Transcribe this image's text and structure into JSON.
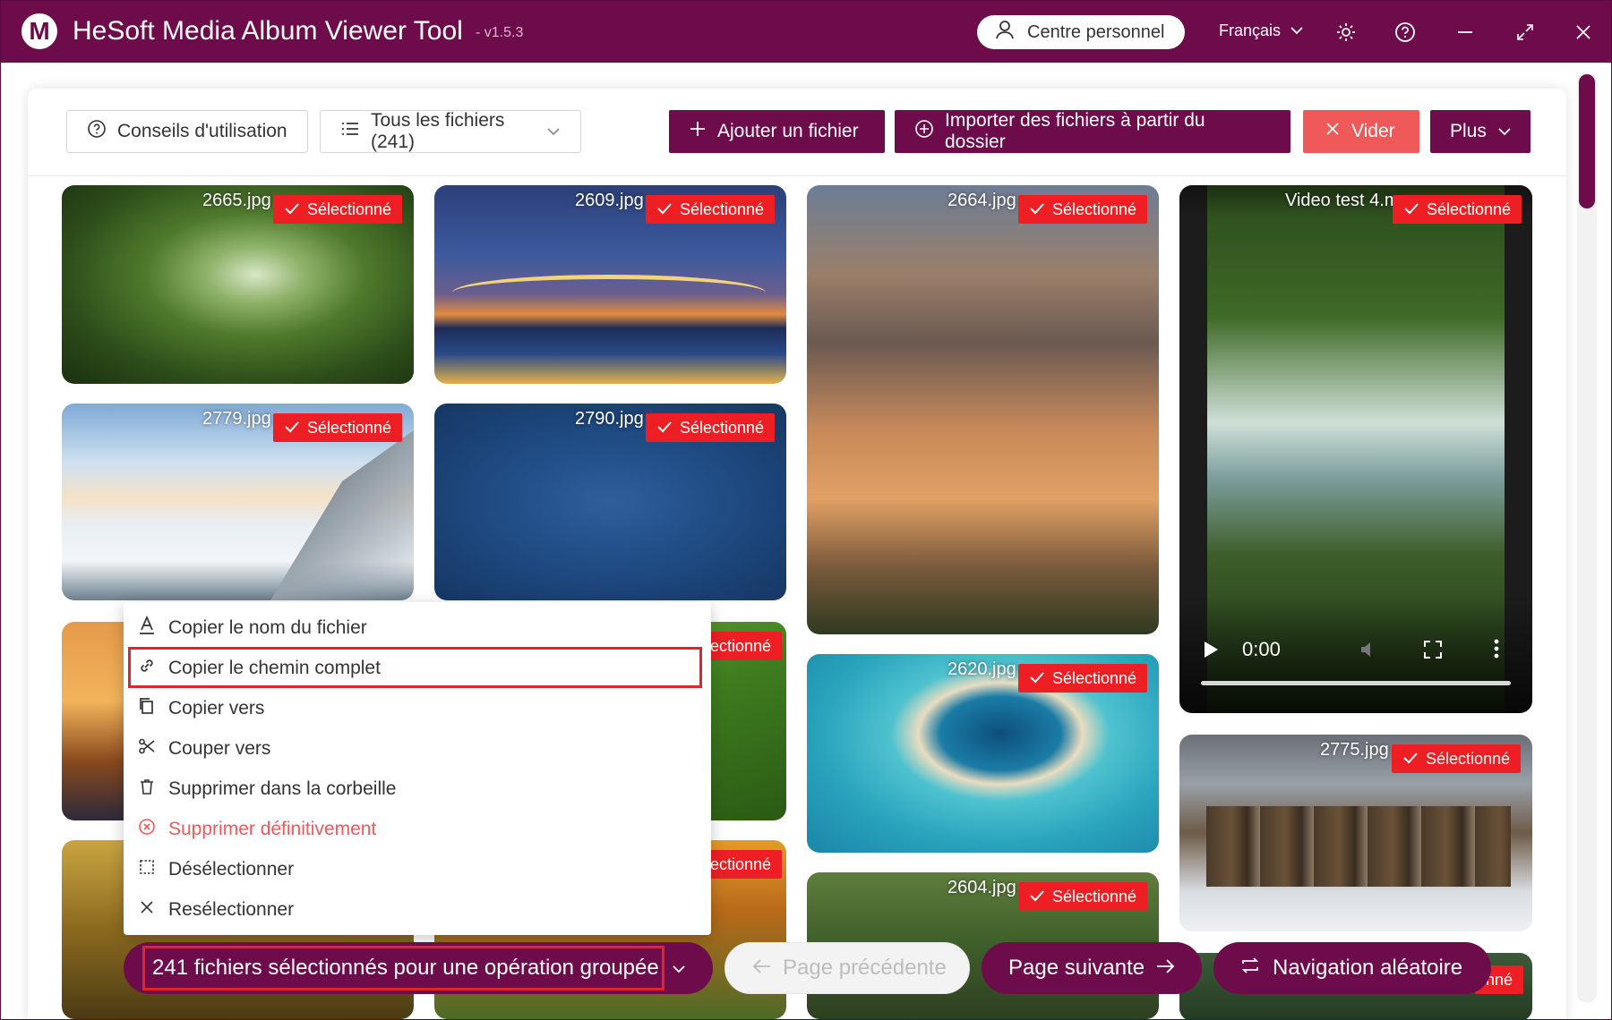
{
  "window": {
    "title": "HeSoft Media Album Viewer Tool",
    "version": "- v1.5.3",
    "logo_letter": "M",
    "personal_center": "Centre personnel",
    "language": "Français"
  },
  "toolbar": {
    "tips": "Conseils d'utilisation",
    "filter": "Tous les fichiers (241)",
    "add_file": "Ajouter un fichier",
    "import_folder": "Importer des fichiers à partir du dossier",
    "clear": "Vider",
    "more": "Plus"
  },
  "selected_label": "Sélectionné",
  "selected_label_partial": "ectionné",
  "selected_label_tail": "nné",
  "tiles": {
    "t1": "2665.jpg",
    "t2": "2609.jpg",
    "t3": "2664.jpg",
    "t4": "Video test 4.m",
    "t5": "2779.jpg",
    "t6": "2790.jpg",
    "t7": "2620.jpg",
    "t8": "2775.jpg",
    "t9": "2604.jpg"
  },
  "video": {
    "time": "0:00"
  },
  "context_menu": {
    "copy_name": "Copier le nom du fichier",
    "copy_path": "Copier le chemin complet",
    "copy_to": "Copier vers",
    "cut_to": "Couper vers",
    "trash": "Supprimer dans la corbeille",
    "delete_forever": "Supprimer définitivement",
    "deselect": "Désélectionner",
    "reselect": "Resélectionner"
  },
  "bottom": {
    "batch": "241 fichiers sélectionnés pour une opération groupée",
    "prev": "Page précédente",
    "next": "Page suivante",
    "random": "Navigation aléatoire"
  },
  "colors": {
    "brand": "#6e0b4b",
    "selected_badge": "#ee1f24",
    "danger": "#f0595a",
    "highlight": "#e0242a"
  }
}
